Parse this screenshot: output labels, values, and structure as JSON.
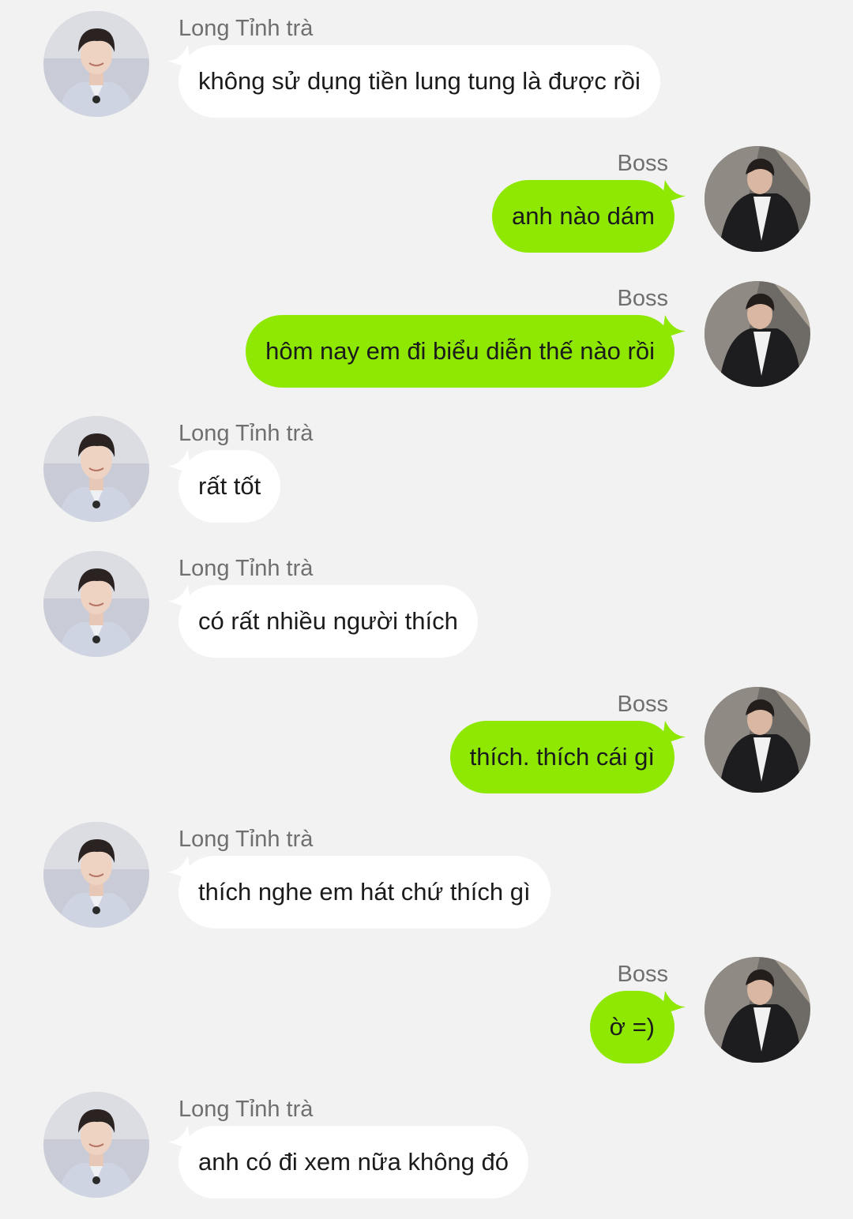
{
  "participants": {
    "left": {
      "name": "Long Tỉnh trà",
      "avatar": "young-man-avatar"
    },
    "right": {
      "name": "Boss",
      "avatar": "man-in-suit-avatar"
    }
  },
  "colors": {
    "background": "#f2f2f2",
    "incoming_bubble": "#ffffff",
    "outgoing_bubble": "#8ee802",
    "sender_name": "#6f6f6f",
    "text": "#1b1b1b"
  },
  "messages": [
    {
      "side": "left",
      "sender": "Long Tỉnh trà",
      "text": "không sử dụng tiền lung tung là được rồi"
    },
    {
      "side": "right",
      "sender": "Boss",
      "text": "anh nào dám"
    },
    {
      "side": "right",
      "sender": "Boss",
      "text": "hôm nay em đi biểu diễn thế nào rồi"
    },
    {
      "side": "left",
      "sender": "Long Tỉnh trà",
      "text": "rất tốt"
    },
    {
      "side": "left",
      "sender": "Long Tỉnh trà",
      "text": "có rất nhiều người thích"
    },
    {
      "side": "right",
      "sender": "Boss",
      "text": "thích. thích cái gì"
    },
    {
      "side": "left",
      "sender": "Long Tỉnh trà",
      "text": "thích nghe em hát chứ thích gì"
    },
    {
      "side": "right",
      "sender": "Boss",
      "text": "ờ =)"
    },
    {
      "side": "left",
      "sender": "Long Tỉnh trà",
      "text": "anh có đi xem nữa không đó"
    }
  ]
}
